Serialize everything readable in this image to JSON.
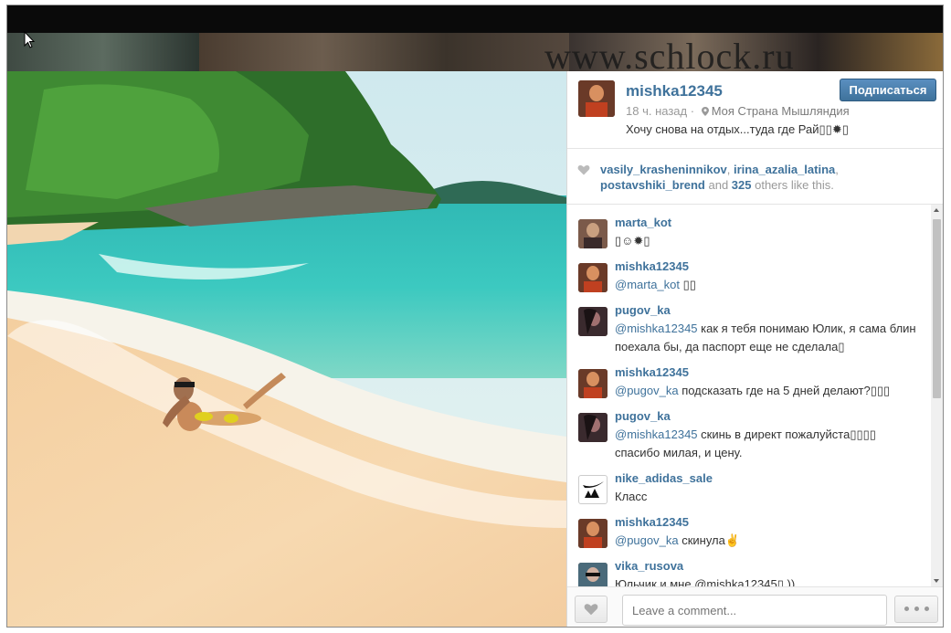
{
  "watermark": "www.schlock.ru",
  "post": {
    "username": "mishka12345",
    "follow_label": "Подписаться",
    "time": "18 ч. назад",
    "separator": "·",
    "location": "Моя Страна Мышляндия",
    "caption": "Хочу снова на отдых...туда где Рай▯▯✹▯"
  },
  "likes": {
    "users": [
      "vasily_krasheninnikov",
      "irina_azalia_latina",
      "postavshiki_brend"
    ],
    "sep1": ", ",
    "sep2": ",",
    "and": " and ",
    "count": "325",
    "others": " others like this."
  },
  "comments": [
    {
      "user": "marta_kot",
      "text": "▯☺✹▯",
      "mention": "",
      "avatar_color": "#7b5a4a"
    },
    {
      "user": "mishka12345",
      "mention": "@marta_kot",
      "text": " ▯▯",
      "avatar_color": "#6a3a28"
    },
    {
      "user": "pugov_ka",
      "mention": "@mishka12345",
      "text": " как я тебя понимаю Юлик, я сама блин поехала бы, да паспорт еще не сделала▯",
      "avatar_color": "#3a2a2e"
    },
    {
      "user": "mishka12345",
      "mention": "@pugov_ka",
      "text": " подсказать где на 5 дней делают?▯▯▯",
      "avatar_color": "#6a3a28"
    },
    {
      "user": "pugov_ka",
      "mention": "@mishka12345",
      "text": " скинь в директ пожалуйста▯▯▯▯ спасибо милая, и цену.",
      "avatar_color": "#3a2a2e"
    },
    {
      "user": "nike_adidas_sale",
      "mention": "",
      "text": "Класс",
      "avatar_color": "#ffffff"
    },
    {
      "user": "mishka12345",
      "mention": "@pugov_ka",
      "text": " скинула✌",
      "avatar_color": "#6a3a28"
    },
    {
      "user": "vika_rusova",
      "mention": "",
      "text": "Юльчик и мне @mishka12345▯ ))",
      "avatar_color": "#4a6a7a"
    }
  ],
  "comment_box": {
    "placeholder": "Leave a comment..."
  },
  "colors": {
    "link": "#3f729b",
    "follow_button": "#3f729b"
  }
}
